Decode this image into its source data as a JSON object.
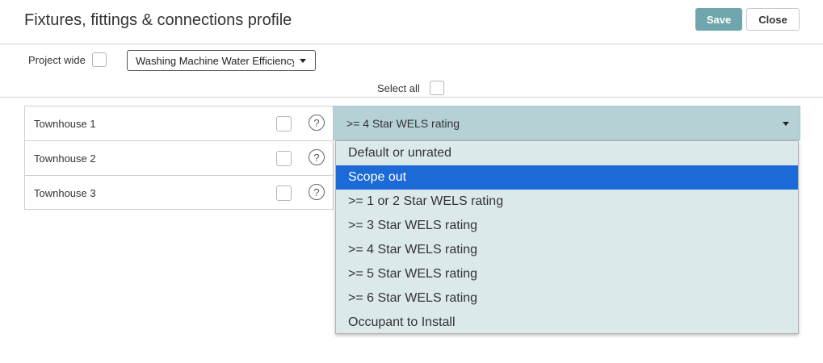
{
  "header": {
    "title": "Fixtures, fittings & connections profile",
    "save_label": "Save",
    "close_label": "Close"
  },
  "controls": {
    "project_wide_label": "Project wide",
    "fixture_selector_value": "Washing Machine Water Efficiency",
    "select_all_label": "Select all"
  },
  "rows": [
    {
      "label": "Townhouse 1"
    },
    {
      "label": "Townhouse 2"
    },
    {
      "label": "Townhouse 3"
    }
  ],
  "active_row": {
    "selected_value": ">= 4 Star WELS rating"
  },
  "dropdown": {
    "options": [
      "Default or unrated",
      "Scope out",
      ">= 1 or 2 Star WELS rating",
      ">= 3 Star WELS rating",
      ">= 4 Star WELS rating",
      ">= 5 Star WELS rating",
      ">= 6 Star WELS rating",
      "Occupant to Install"
    ],
    "highlighted_option": "Scope out"
  },
  "icons": {
    "help": "?",
    "dropdown_caret": "caret-down-icon"
  },
  "colors": {
    "save_button": "#6fa6ad",
    "combo_background": "#b6d1d5",
    "dropdown_background": "#dce9eb",
    "highlight": "#1c6ad8"
  }
}
